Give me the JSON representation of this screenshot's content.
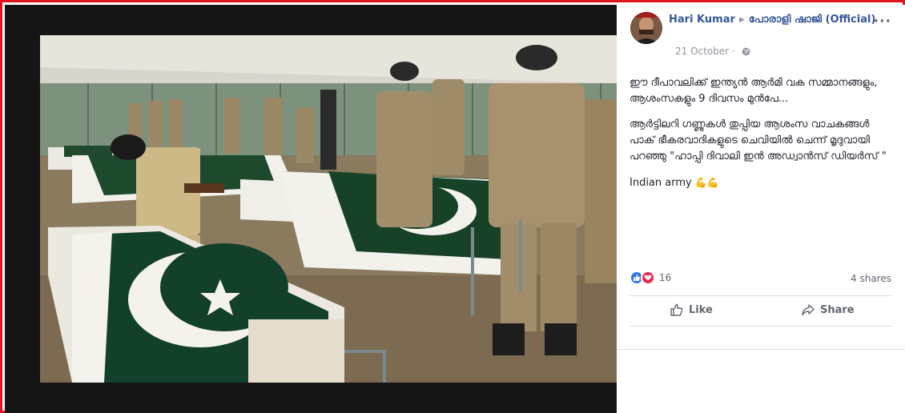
{
  "post": {
    "author": "Hari Kumar",
    "page_name": "പോരാളി ഷാജി (Official)",
    "date": "21 October",
    "date_separator": "·",
    "menu_label": "···",
    "text_paragraphs": [
      "ഈ ദീപാവലിക്ക് ഇന്ത്യൻ ആർമി വക സമ്മാനങ്ങളും, ആശംസകളും 9 ദിവസം മുൻപേ...",
      "ആർട്ടിലറി ഗണ്ണുകൾ തുപ്പിയ ആശംസ വാചകങ്ങൾ പാക് ഭീകരവാദികളുടെ ചെവിയിൽ ചെന്ന് മൃദുവായി പറഞ്ഞു \"ഹാപ്പി ദിവാലി ഇൻ അഡ്വാൻസ് ഡിയർസ് \""
    ],
    "closing_text": "Indian army",
    "closing_emoji": "💪💪",
    "reaction_count": "16",
    "shares": "4 shares",
    "like_label": "Like",
    "share_label": "Share"
  },
  "colors": {
    "frame": "#e0141c",
    "link": "#365899",
    "meta": "#90949c",
    "like_blue": "#3578e5",
    "love_red": "#f0284a"
  },
  "icons": [
    "triangle-right-icon",
    "globe-icon",
    "like-reaction-icon",
    "love-reaction-icon",
    "thumbs-up-icon",
    "share-arrow-icon",
    "more-options-icon"
  ]
}
